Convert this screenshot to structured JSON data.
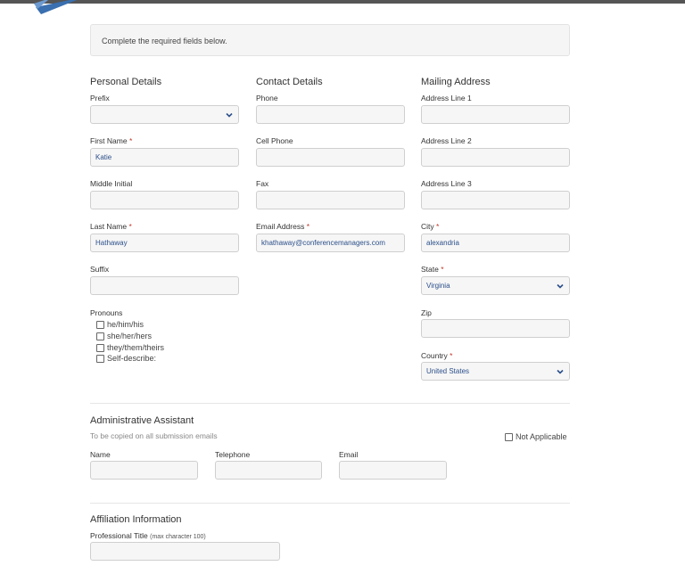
{
  "notice": "Complete the required fields below.",
  "personal": {
    "title": "Personal Details",
    "prefix_label": "Prefix",
    "prefix_value": "",
    "first_name_label": "First Name",
    "first_name_value": "Katie",
    "middle_initial_label": "Middle Initial",
    "middle_initial_value": "",
    "last_name_label": "Last Name",
    "last_name_value": "Hathaway",
    "suffix_label": "Suffix",
    "suffix_value": "",
    "pronouns_label": "Pronouns",
    "pronouns": [
      "he/him/his",
      "she/her/hers",
      "they/them/theirs",
      "Self-describe:"
    ]
  },
  "contact": {
    "title": "Contact Details",
    "phone_label": "Phone",
    "phone_value": "",
    "cell_label": "Cell Phone",
    "cell_value": "",
    "fax_label": "Fax",
    "fax_value": "",
    "email_label": "Email Address",
    "email_value": "khathaway@conferencemanagers.com"
  },
  "mailing": {
    "title": "Mailing Address",
    "line1_label": "Address Line 1",
    "line1_value": "",
    "line2_label": "Address Line 2",
    "line2_value": "",
    "line3_label": "Address Line 3",
    "line3_value": "",
    "city_label": "City",
    "city_value": "alexandria",
    "state_label": "State",
    "state_value": "Virginia",
    "zip_label": "Zip",
    "zip_value": "",
    "country_label": "Country",
    "country_value": "United States"
  },
  "required_marker": "*",
  "assistant": {
    "title": "Administrative Assistant",
    "help": "To be copied on all submission emails",
    "not_applicable": "Not Applicable",
    "name_label": "Name",
    "telephone_label": "Telephone",
    "email_label": "Email"
  },
  "affiliation": {
    "title": "Affiliation Information",
    "professional_title_label": "Professional Title",
    "professional_title_hint": "(max character 100)",
    "professional_title_value": ""
  },
  "colors": {
    "required": "#c0392b",
    "chevron": "#2b4f8a",
    "logo": "#3a6fb0"
  },
  "icons": {
    "select": "chevron-down-icon",
    "logo": "logo-icon"
  }
}
